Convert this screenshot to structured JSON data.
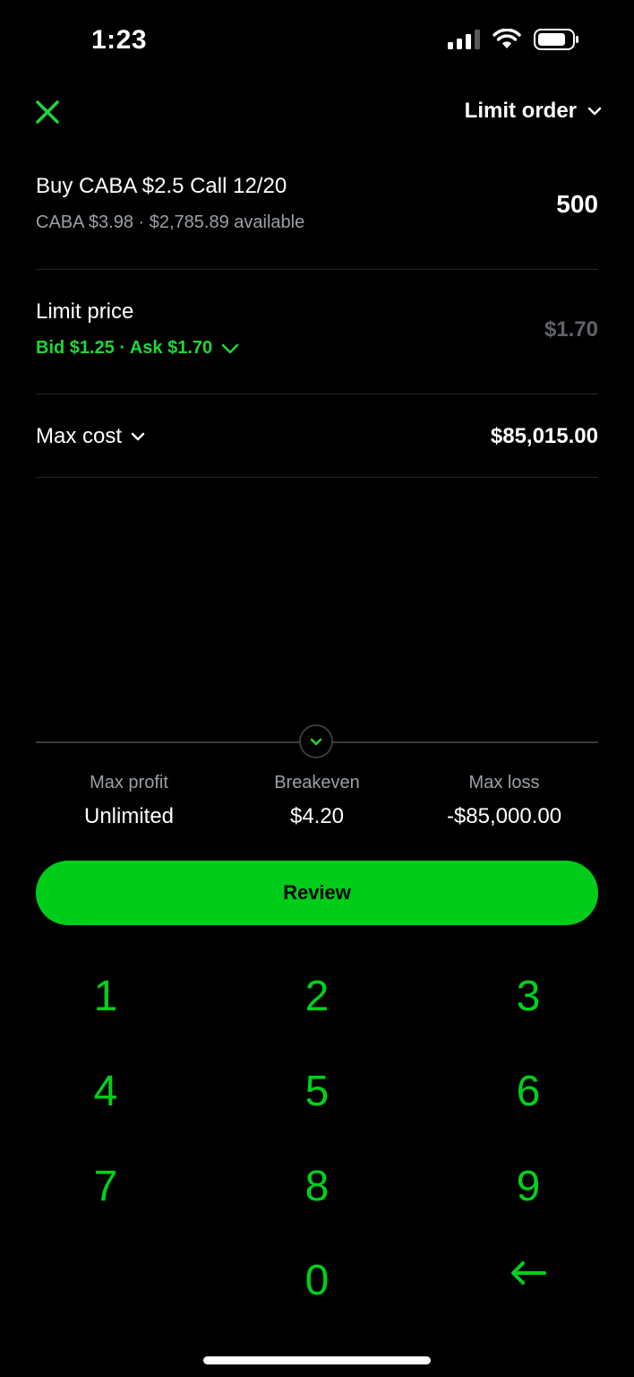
{
  "status_bar": {
    "time": "1:23"
  },
  "header": {
    "close_icon": "close-icon",
    "order_type": "Limit order"
  },
  "contract": {
    "title": "Buy CABA $2.5 Call 12/20",
    "subtitle": "CABA $3.98 · $2,785.89 available",
    "quantity": "500"
  },
  "limit_price": {
    "label": "Limit price",
    "bid_ask": "Bid $1.25 · Ask $1.70",
    "value": "$1.70"
  },
  "max_cost": {
    "label": "Max cost",
    "value": "$85,015.00"
  },
  "stats": [
    {
      "label": "Max profit",
      "value": "Unlimited"
    },
    {
      "label": "Breakeven",
      "value": "$4.20"
    },
    {
      "label": "Max loss",
      "value": "-$85,000.00"
    }
  ],
  "review_button": "Review",
  "keypad": {
    "keys": [
      "1",
      "2",
      "3",
      "4",
      "5",
      "6",
      "7",
      "8",
      "9",
      "0"
    ],
    "backspace_icon": "backspace-arrow-icon"
  },
  "colors": {
    "accent": "#00cc1a",
    "background": "#000000",
    "muted": "#9aa0a6"
  }
}
